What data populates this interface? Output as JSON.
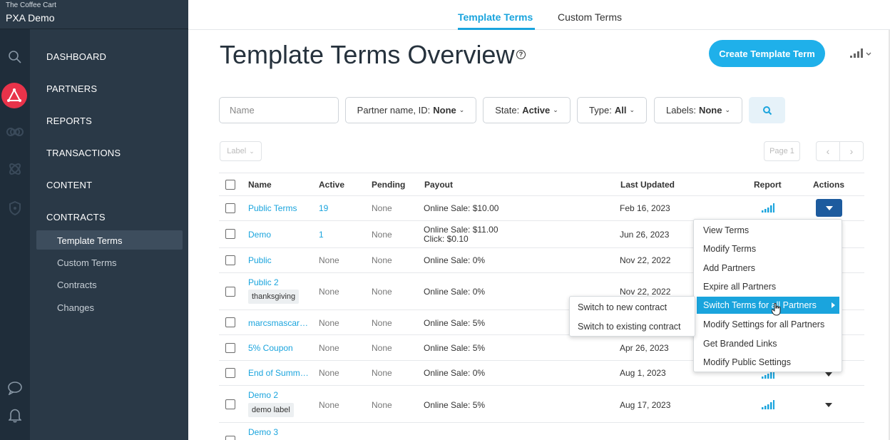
{
  "brand": {
    "company": "The Coffee Cart",
    "app": "PXA Demo"
  },
  "rail_icons": [
    "search-icon",
    "partnerize-logo-icon",
    "infinity-icon",
    "atom-icon",
    "shield-icon",
    "chat-icon",
    "bell-icon"
  ],
  "nav": {
    "main": [
      "DASHBOARD",
      "PARTNERS",
      "REPORTS",
      "TRANSACTIONS",
      "CONTENT",
      "CONTRACTS"
    ],
    "sub": [
      "Template Terms",
      "Custom Terms",
      "Contracts",
      "Changes"
    ],
    "selected": "Template Terms"
  },
  "tabs": [
    "Template Terms",
    "Custom Terms"
  ],
  "page": {
    "title": "Template Terms Overview",
    "help": "?",
    "create_label": "Create Template Term"
  },
  "filters": {
    "name_placeholder": "Name",
    "partner": {
      "label": "Partner name, ID:",
      "value": "None"
    },
    "state": {
      "label": "State:",
      "value": "Active"
    },
    "type": {
      "label": "Type:",
      "value": "All"
    },
    "labels": {
      "label": "Labels:",
      "value": "None"
    }
  },
  "label_dropdown": "Label",
  "pagination": {
    "page": "Page 1",
    "prev": "‹",
    "next": "›"
  },
  "table": {
    "headers": [
      "Name",
      "Active",
      "Pending",
      "Payout",
      "Last Updated",
      "Report",
      "Actions"
    ],
    "rows": [
      {
        "name": "Public Terms",
        "active": "19",
        "pending": "None",
        "payout": [
          "Online Sale: $10.00"
        ],
        "updated": "Feb 16, 2023",
        "label": ""
      },
      {
        "name": "Demo",
        "active": "1",
        "pending": "None",
        "payout": [
          "Online Sale: $11.00",
          "Click: $0.10"
        ],
        "updated": "Jun 26, 2023",
        "label": ""
      },
      {
        "name": "Public",
        "active": "None",
        "pending": "None",
        "payout": [
          "Online Sale: 0%"
        ],
        "updated": "Nov 22, 2022",
        "label": ""
      },
      {
        "name": "Public 2",
        "active": "None",
        "pending": "None",
        "payout": [
          "Online Sale: 0%"
        ],
        "updated": "Nov 22, 2022",
        "label": "thanksgiving"
      },
      {
        "name": "marcsmascar…",
        "active": "None",
        "pending": "None",
        "payout": [
          "Online Sale: 5%"
        ],
        "updated": "",
        "label": ""
      },
      {
        "name": "5% Coupon",
        "active": "None",
        "pending": "None",
        "payout": [
          "Online Sale: 5%"
        ],
        "updated": "Apr 26, 2023",
        "label": ""
      },
      {
        "name": "End of Summ…",
        "active": "None",
        "pending": "None",
        "payout": [
          "Online Sale: 0%"
        ],
        "updated": "Aug 1, 2023",
        "label": ""
      },
      {
        "name": "Demo 2",
        "active": "None",
        "pending": "None",
        "payout": [
          "Online Sale: 5%"
        ],
        "updated": "Aug 17, 2023",
        "label": "demo label"
      },
      {
        "name": "Demo 3",
        "active": "",
        "pending": "",
        "payout": [
          ""
        ],
        "updated": "",
        "label": ""
      }
    ]
  },
  "actions_menu": [
    "View Terms",
    "Modify Terms",
    "Add Partners",
    "Expire all Partners",
    "Switch Terms for all Partners",
    "Modify Settings for all Partners",
    "Get Branded Links",
    "Modify Public Settings"
  ],
  "actions_menu_highlighted": "Switch Terms for all Partners",
  "submenu": [
    "Switch to new contract",
    "Switch to existing contract"
  ],
  "colors": {
    "accent": "#1aa4dd",
    "sidebar": "#2a3947",
    "rail": "#1f2d3a",
    "action_button": "#1d5b9e",
    "logo_red": "#e8334a"
  }
}
